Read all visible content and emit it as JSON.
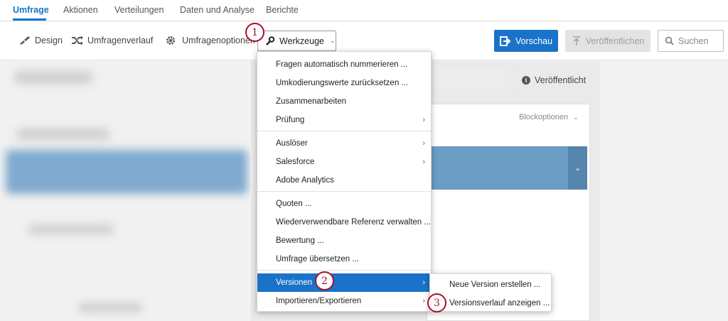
{
  "topnav": {
    "tabs": [
      {
        "label": "Umfrage",
        "active": true
      },
      {
        "label": "Aktionen"
      },
      {
        "label": "Verteilungen"
      },
      {
        "label": "Daten und Analyse"
      },
      {
        "label": "Berichte"
      }
    ]
  },
  "toolbar": {
    "design": "Design",
    "history": "Umfragenverlauf",
    "options": "Umfragenoptionen",
    "tools": "Werkzeuge",
    "preview": "Vorschau",
    "publish": "Veröffentlichen",
    "search_placeholder": "Suchen"
  },
  "canvas": {
    "published_label": "Veröffentlicht",
    "block_options": "Blockoptionen"
  },
  "menu": {
    "items": [
      {
        "label": "Fragen automatisch nummerieren ..."
      },
      {
        "label": "Umkodierungswerte zurücksetzen ..."
      },
      {
        "label": "Zusammenarbeiten"
      },
      {
        "label": "Prüfung",
        "has_submenu": true
      },
      {
        "label": "Auslöser",
        "has_submenu": true
      },
      {
        "label": "Salesforce",
        "has_submenu": true
      },
      {
        "label": "Adobe Analytics"
      },
      {
        "label": "Quoten ..."
      },
      {
        "label": "Wiederverwendbare Referenz verwalten ..."
      },
      {
        "label": "Bewertung ..."
      },
      {
        "label": "Umfrage übersetzen ..."
      },
      {
        "label": "Versionen",
        "has_submenu": true,
        "active": true
      },
      {
        "label": "Importieren/Exportieren",
        "has_submenu": true
      }
    ]
  },
  "submenu": {
    "items": [
      {
        "label": "Neue Version erstellen ..."
      },
      {
        "label": "Versionsverlauf anzeigen ..."
      }
    ]
  },
  "callouts": [
    "1",
    "2",
    "3"
  ],
  "colors": {
    "accent": "#1a73c9",
    "callout": "#a8102a",
    "block_header": "#6a9cc4"
  }
}
